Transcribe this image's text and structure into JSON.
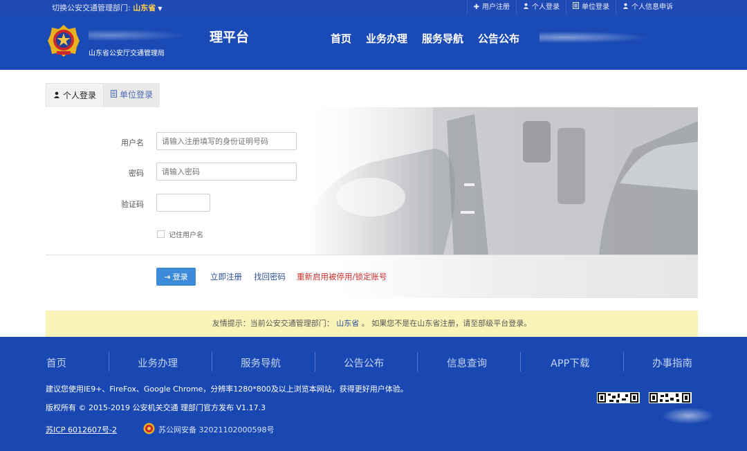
{
  "topbar": {
    "region_prefix": "切换公安交通管理部门:",
    "region_value": "山东省",
    "links": [
      {
        "icon": "plus-icon",
        "label": "用户注册"
      },
      {
        "icon": "user-icon",
        "label": "个人登录"
      },
      {
        "icon": "building-icon",
        "label": "单位登录"
      },
      {
        "icon": "user-icon",
        "label": "个人信息申诉"
      }
    ]
  },
  "header": {
    "org_name": "山东省公安厅交通管理局",
    "platform_title": "理平台",
    "nav": [
      "首页",
      "业务办理",
      "服务导航",
      "公告公布"
    ]
  },
  "login": {
    "tabs": [
      {
        "icon": "user-icon",
        "label": "个人登录",
        "active": true
      },
      {
        "icon": "building-icon",
        "label": "单位登录",
        "active": false
      }
    ],
    "username_label": "用户名",
    "username_placeholder": "请输入注册填写的身份证明号码",
    "password_label": "密码",
    "password_placeholder": "请输入密码",
    "captcha_label": "验证码",
    "captcha_value": "",
    "remember_label": "记住用户名",
    "remember_checked": false,
    "login_button": "登录",
    "register_link": "立即注册",
    "recover_link": "找回密码",
    "reactivate_link": "重新启用被停用/锁定账号"
  },
  "notice": {
    "prefix": "友情提示：当前公安交通管理部门：",
    "province": "山东省",
    "suffix": "。 如果您不是在山东省注册，请至部级平台登录。"
  },
  "footer": {
    "nav": [
      "首页",
      "业务办理",
      "服务导航",
      "公告公布",
      "信息查询",
      "APP下载",
      "办事指南"
    ],
    "browser_tip": "建议您使用IE9+、FireFox、Google Chrome，分辨率1280*800及以上浏览本网站，获得更好用户体验。",
    "copyright": "版权所有 © 2015-2019 公安机关交通   理部门官方发布 V1.17.3",
    "icp": "苏ICP   6012607号-2",
    "beian": "苏公网安备 32021102000598号"
  },
  "colors": {
    "brand_blue": "#1a4ab6",
    "link_red": "#c9302c",
    "button_blue": "#3d8ad9",
    "notice_yellow": "#fbf4b8"
  }
}
